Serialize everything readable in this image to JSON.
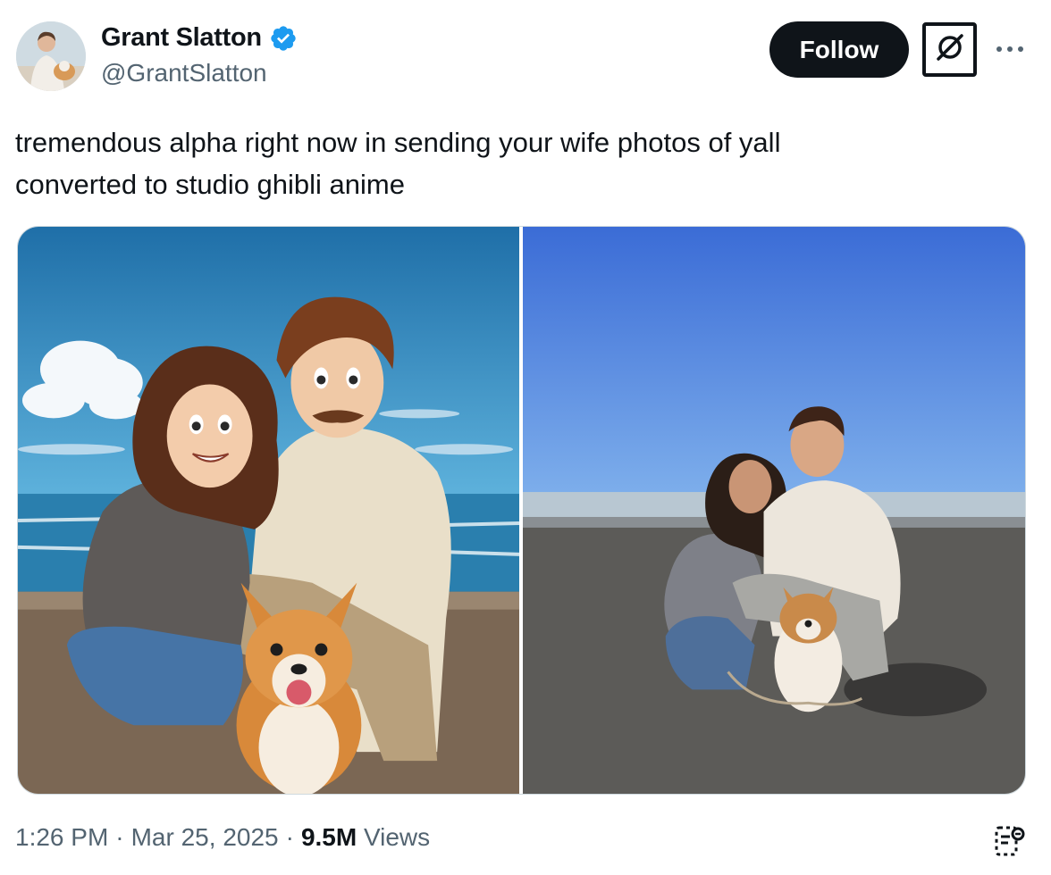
{
  "author": {
    "display_name": "Grant Slatton",
    "handle": "@GrantSlatton",
    "verified": true,
    "avatar_icon": "profile-photo"
  },
  "actions": {
    "follow_label": "Follow",
    "grok_icon": "grok-icon",
    "more_icon": "more-horizontal-icon"
  },
  "tweet": {
    "text": "tremendous alpha right now in sending your wife photos of yall converted to studio ghibli anime"
  },
  "media": [
    {
      "kind": "image",
      "description_icon": "anime-illustration-image"
    },
    {
      "kind": "image",
      "description_icon": "beach-photo-image"
    }
  ],
  "meta": {
    "time": "1:26 PM",
    "separator": "·",
    "date": "Mar 25, 2025",
    "views_count": "9.5M",
    "views_label": "Views"
  },
  "colors": {
    "text_primary": "#0f1419",
    "text_secondary": "#536471",
    "verified_blue": "#1d9bf0",
    "border": "#cfd9de"
  }
}
